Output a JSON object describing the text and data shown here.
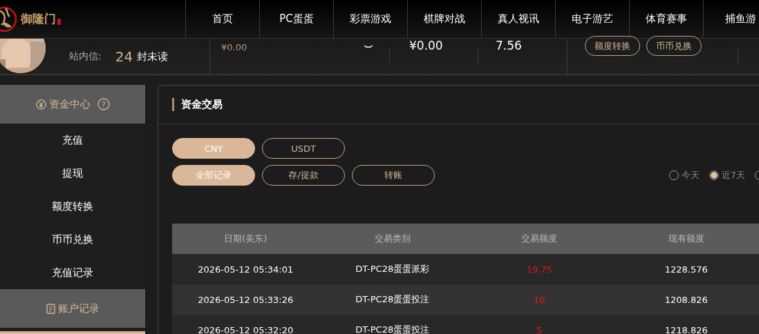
{
  "logo": {
    "text": "御隆门"
  },
  "nav": [
    {
      "label": "首页"
    },
    {
      "label": "PC蛋蛋"
    },
    {
      "label": "彩票游戏"
    },
    {
      "label": "棋牌对战"
    },
    {
      "label": "真人视讯"
    },
    {
      "label": "电子游艺"
    },
    {
      "label": "体育赛事"
    },
    {
      "label": "捕鱼游"
    }
  ],
  "account": {
    "inbox_label": "站内信:",
    "unread_count": "24",
    "unread_suffix": "封未读",
    "balance_small": "¥0.00",
    "balance": "¥0.00",
    "points": "7.56",
    "buttons": [
      "额度转换",
      "币币兑换"
    ]
  },
  "sidebar": {
    "sections": [
      {
        "title": "资金中心",
        "help": "?",
        "items": [
          "充值",
          "提现",
          "额度转换",
          "币币兑换",
          "充值记录"
        ]
      },
      {
        "title": "账户记录"
      }
    ]
  },
  "panel": {
    "title": "资金交易",
    "currencies": [
      {
        "label": "CNY",
        "selected": true
      },
      {
        "label": "USDT",
        "selected": false
      }
    ],
    "filters": [
      {
        "label": "全部记录",
        "selected": true
      },
      {
        "label": "存/提款",
        "selected": false
      },
      {
        "label": "转账",
        "selected": false
      }
    ],
    "periods": [
      {
        "label": "今天",
        "selected": false
      },
      {
        "label": "近7天",
        "selected": true
      },
      {
        "selected": false
      }
    ],
    "table": {
      "columns": [
        "日期(美东)",
        "交易类别",
        "交易额度",
        "现有额度"
      ],
      "rows": [
        [
          "2026-05-12 05:34:01",
          "DT-PC28蛋蛋派彩",
          "19.75",
          "1228.576"
        ],
        [
          "2026-05-12 05:33:26",
          "DT-PC28蛋蛋投注",
          "10",
          "1208.826"
        ],
        [
          "2026-05-12 05:32:20",
          "DT-PC28蛋蛋投注",
          "5",
          "1218.826"
        ]
      ]
    }
  }
}
